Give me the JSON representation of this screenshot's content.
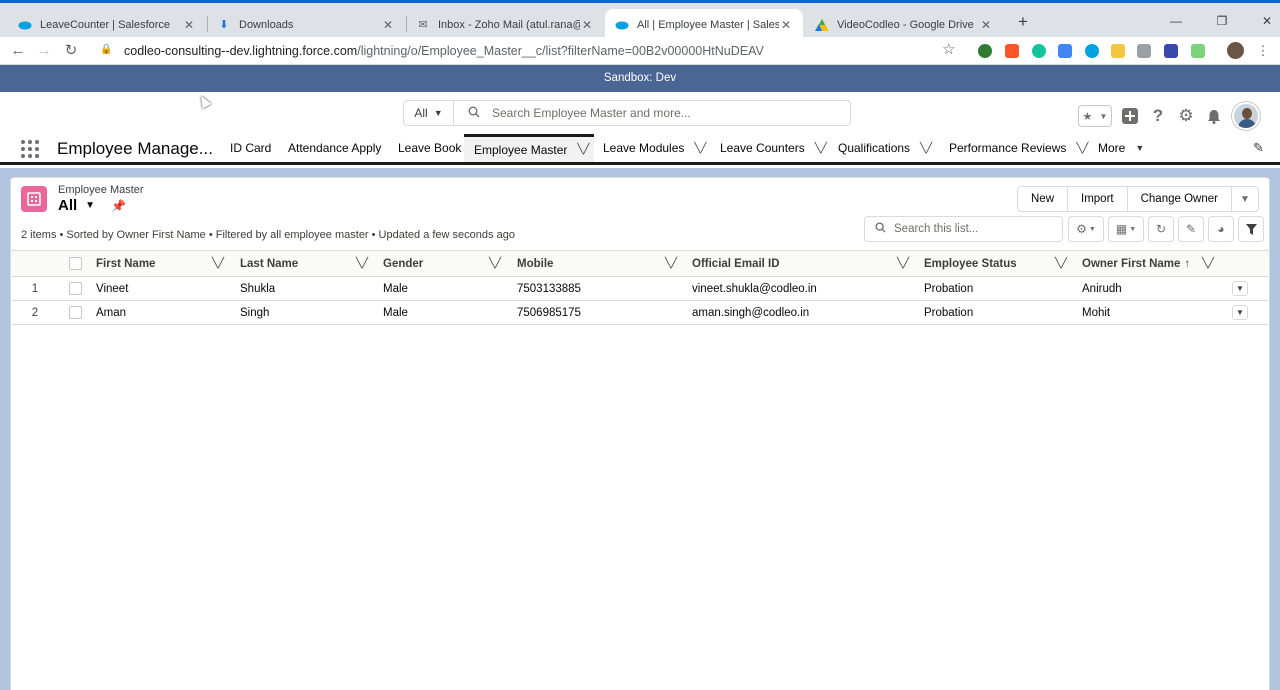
{
  "browser": {
    "tabs": [
      {
        "title": "LeaveCounter | Salesforce",
        "icon": "salesforce-cloud-icon"
      },
      {
        "title": "Downloads",
        "icon": "download-icon"
      },
      {
        "title": "Inbox - Zoho Mail (atul.rana@co",
        "icon": "mail-icon"
      },
      {
        "title": "All | Employee Master | Salesforce",
        "icon": "salesforce-cloud-icon"
      },
      {
        "title": "VideoCodleo - Google Drive",
        "icon": "drive-icon"
      }
    ],
    "url_host": "codleo-consulting--dev.lightning.force.com",
    "url_path": "/lightning/o/Employee_Master__c/list?filterName=00B2v00000HtNuDEAV"
  },
  "banner": "Sandbox: Dev",
  "header": {
    "search_scope": "All",
    "search_placeholder": "Search Employee Master and more..."
  },
  "appnav": {
    "app_name": "Employee Manage...",
    "items": [
      {
        "label": "ID Card",
        "has_menu": false
      },
      {
        "label": "Attendance Apply",
        "has_menu": false
      },
      {
        "label": "Leave Book",
        "has_menu": false
      },
      {
        "label": "Employee Master",
        "has_menu": true
      },
      {
        "label": "Leave Modules",
        "has_menu": true
      },
      {
        "label": "Leave Counters",
        "has_menu": true
      },
      {
        "label": "Qualifications",
        "has_menu": true
      },
      {
        "label": "Performance Reviews",
        "has_menu": true
      },
      {
        "label": "More",
        "has_menu": true
      }
    ]
  },
  "list": {
    "object_label": "Employee Master",
    "view_name": "All",
    "buttons": [
      "New",
      "Import",
      "Change Owner"
    ],
    "info": "2 items • Sorted by Owner First Name • Filtered by all employee master • Updated a few seconds ago",
    "search_placeholder": "Search this list...",
    "columns": [
      "First Name",
      "Last Name",
      "Gender",
      "Mobile",
      "Official Email ID",
      "Employee Status",
      "Owner First Name"
    ],
    "sort_indicator": "↑",
    "rows": [
      {
        "num": "1",
        "cells": [
          "Vineet",
          "Shukla",
          "Male",
          "7503133885",
          "vineet.shukla@codleo.in",
          "Probation",
          "Anirudh"
        ]
      },
      {
        "num": "2",
        "cells": [
          "Aman",
          "Singh",
          "Male",
          "7506985175",
          "aman.singh@codleo.in",
          "Probation",
          "Mohit"
        ]
      }
    ]
  },
  "colors": {
    "banner": "#4a6694",
    "object_icon": "#e9679a",
    "page_bg": "#b0c4df"
  }
}
